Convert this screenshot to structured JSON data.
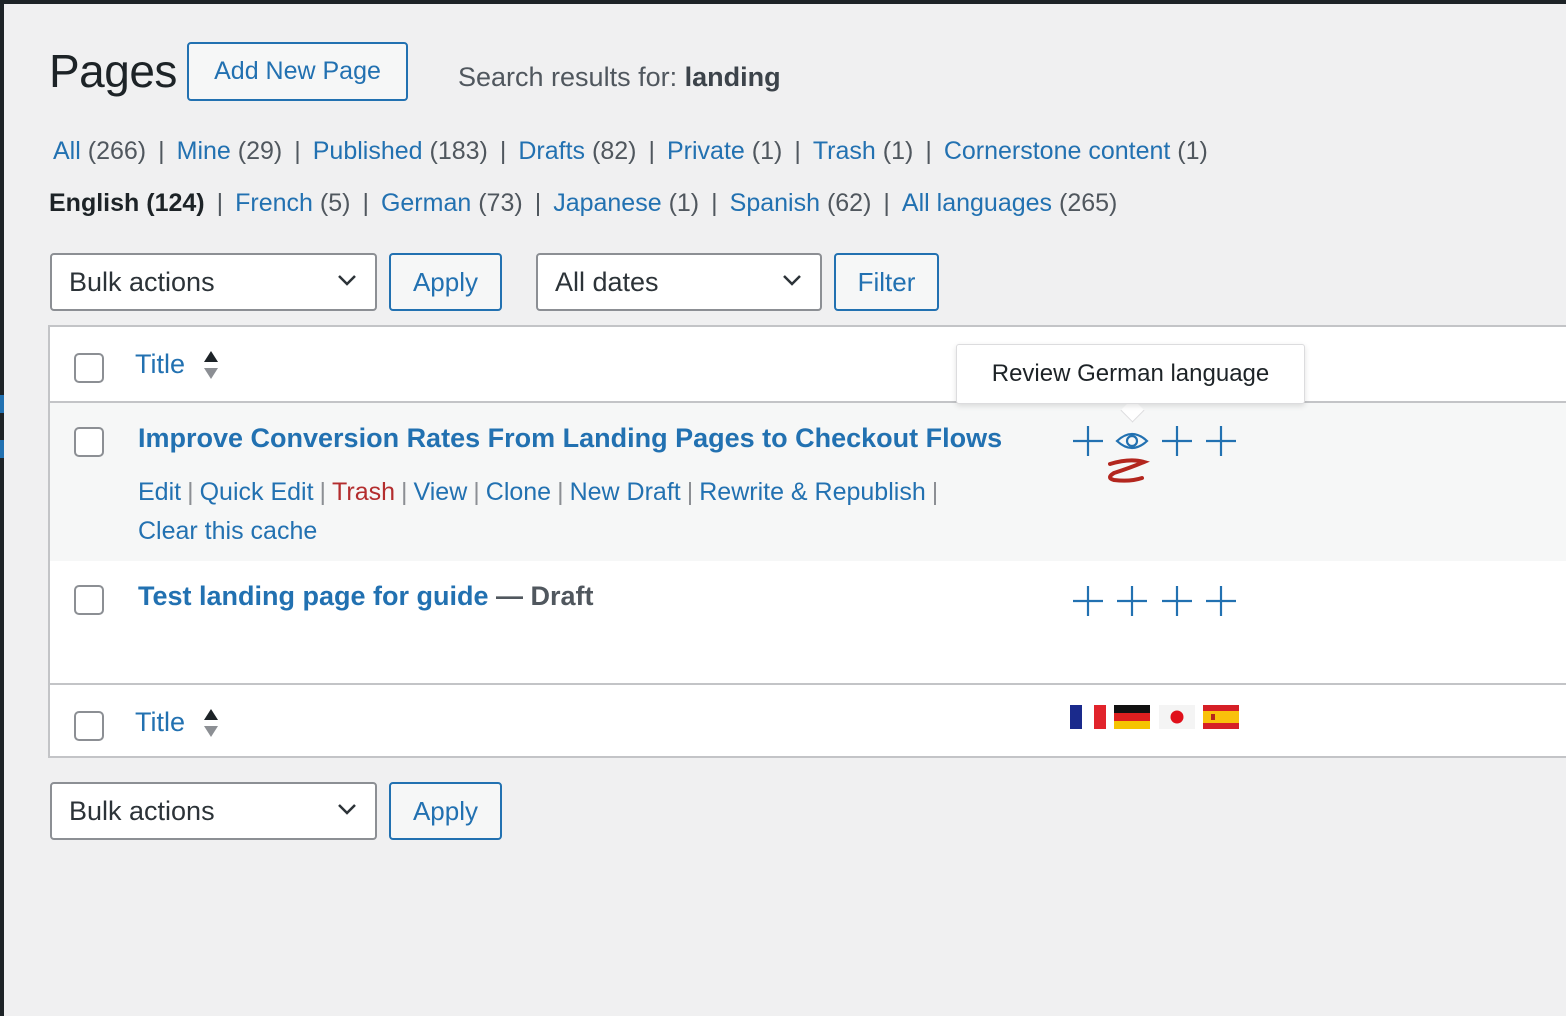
{
  "header": {
    "title": "Pages",
    "add_new_label": "Add New Page",
    "search_prefix": "Search results for: ",
    "search_term": "landing"
  },
  "status_filters": [
    {
      "label": "All",
      "count": "(266)"
    },
    {
      "label": "Mine",
      "count": "(29)"
    },
    {
      "label": "Published",
      "count": "(183)"
    },
    {
      "label": "Drafts",
      "count": "(82)"
    },
    {
      "label": "Private",
      "count": "(1)"
    },
    {
      "label": "Trash",
      "count": "(1)"
    },
    {
      "label": "Cornerstone content",
      "count": " (1)"
    }
  ],
  "language_filters": [
    {
      "label": "English",
      "count": "(124)",
      "current": true
    },
    {
      "label": "French",
      "count": "(5)"
    },
    {
      "label": "German",
      "count": "(73)"
    },
    {
      "label": "Japanese",
      "count": "(1)"
    },
    {
      "label": "Spanish",
      "count": "(62)"
    },
    {
      "label": "All languages",
      "count": "(265)"
    }
  ],
  "toolbar_top": {
    "bulk_actions": "Bulk actions",
    "apply": "Apply",
    "dates": "All dates",
    "filter": "Filter"
  },
  "toolbar_bottom": {
    "bulk_actions": "Bulk actions",
    "apply": "Apply"
  },
  "table": {
    "column_title": "Title",
    "rows": [
      {
        "title": "Improve Conversion Rates From Landing Pages to Checkout Flows",
        "state": "",
        "actions": [
          "Edit",
          "Quick Edit",
          "Trash",
          "View",
          "Clone",
          "New Draft",
          "Rewrite & Republish",
          "Clear this cache"
        ],
        "languages": [
          "plus-icon",
          "eye-icon",
          "plus-icon",
          "plus-icon"
        ]
      },
      {
        "title": "Test landing page for guide",
        "state": " — Draft",
        "languages": [
          "plus-icon",
          "plus-icon",
          "plus-icon",
          "plus-icon"
        ]
      }
    ],
    "footer_flags": [
      "French flag",
      "German flag",
      "Japanese flag",
      "Spanish flag"
    ]
  },
  "tooltip": {
    "text": "Review German language"
  },
  "colors": {
    "link": "#2271b1",
    "trash": "#b32d2e",
    "background": "#f0f0f1",
    "annotation": "#b3261e"
  }
}
